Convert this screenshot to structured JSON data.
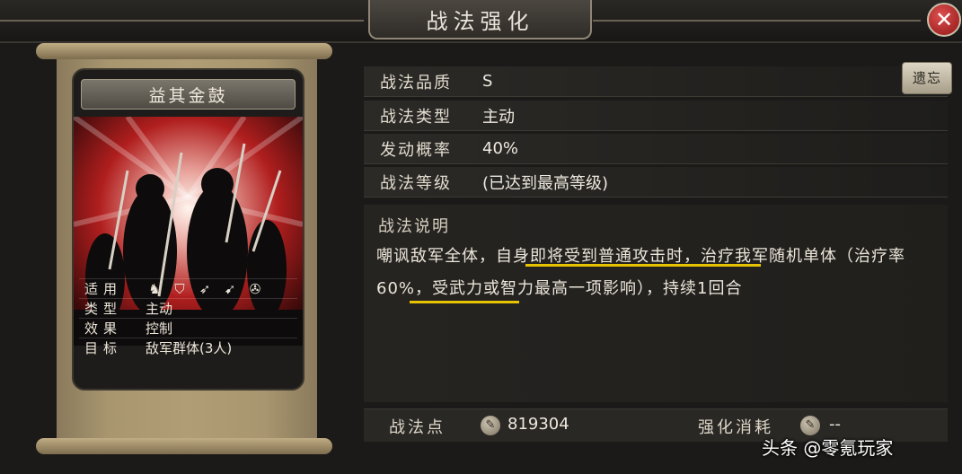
{
  "window": {
    "title": "战法强化",
    "close_icon": "close-icon"
  },
  "card": {
    "name": "益其金鼓",
    "info": [
      {
        "key": "适用",
        "value": ""
      },
      {
        "key": "类型",
        "value": "主动"
      },
      {
        "key": "效果",
        "value": "控制"
      },
      {
        "key": "目标",
        "value": "敌军群体(3人)"
      }
    ],
    "applicable_icons": [
      "cavalry-icon",
      "shield-icon",
      "bow-icon",
      "spear-icon",
      "wheel-icon"
    ]
  },
  "attributes": [
    {
      "key": "战法品质",
      "value": "S"
    },
    {
      "key": "战法类型",
      "value": "主动"
    },
    {
      "key": "发动概率",
      "value": "40%"
    },
    {
      "key": "战法等级",
      "value": "(已达到最高等级)"
    }
  ],
  "forget_button": {
    "label": "遗忘"
  },
  "description": {
    "title": "战法说明",
    "text": "嘲讽敌军全体，自身即将受到普通攻击时，治疗我军随机单体（治疗率60%，受武力或智力最高一项影响），持续1回合"
  },
  "bottom": {
    "points_label": "战法点",
    "points_value": "819304",
    "cost_label": "强化消耗",
    "cost_value": "--"
  },
  "watermark": "头条 @零氪玩家",
  "colors": {
    "highlight_underline": "#e6c200",
    "close_button": "#c42020",
    "card_art_red": "#b01e1e"
  }
}
